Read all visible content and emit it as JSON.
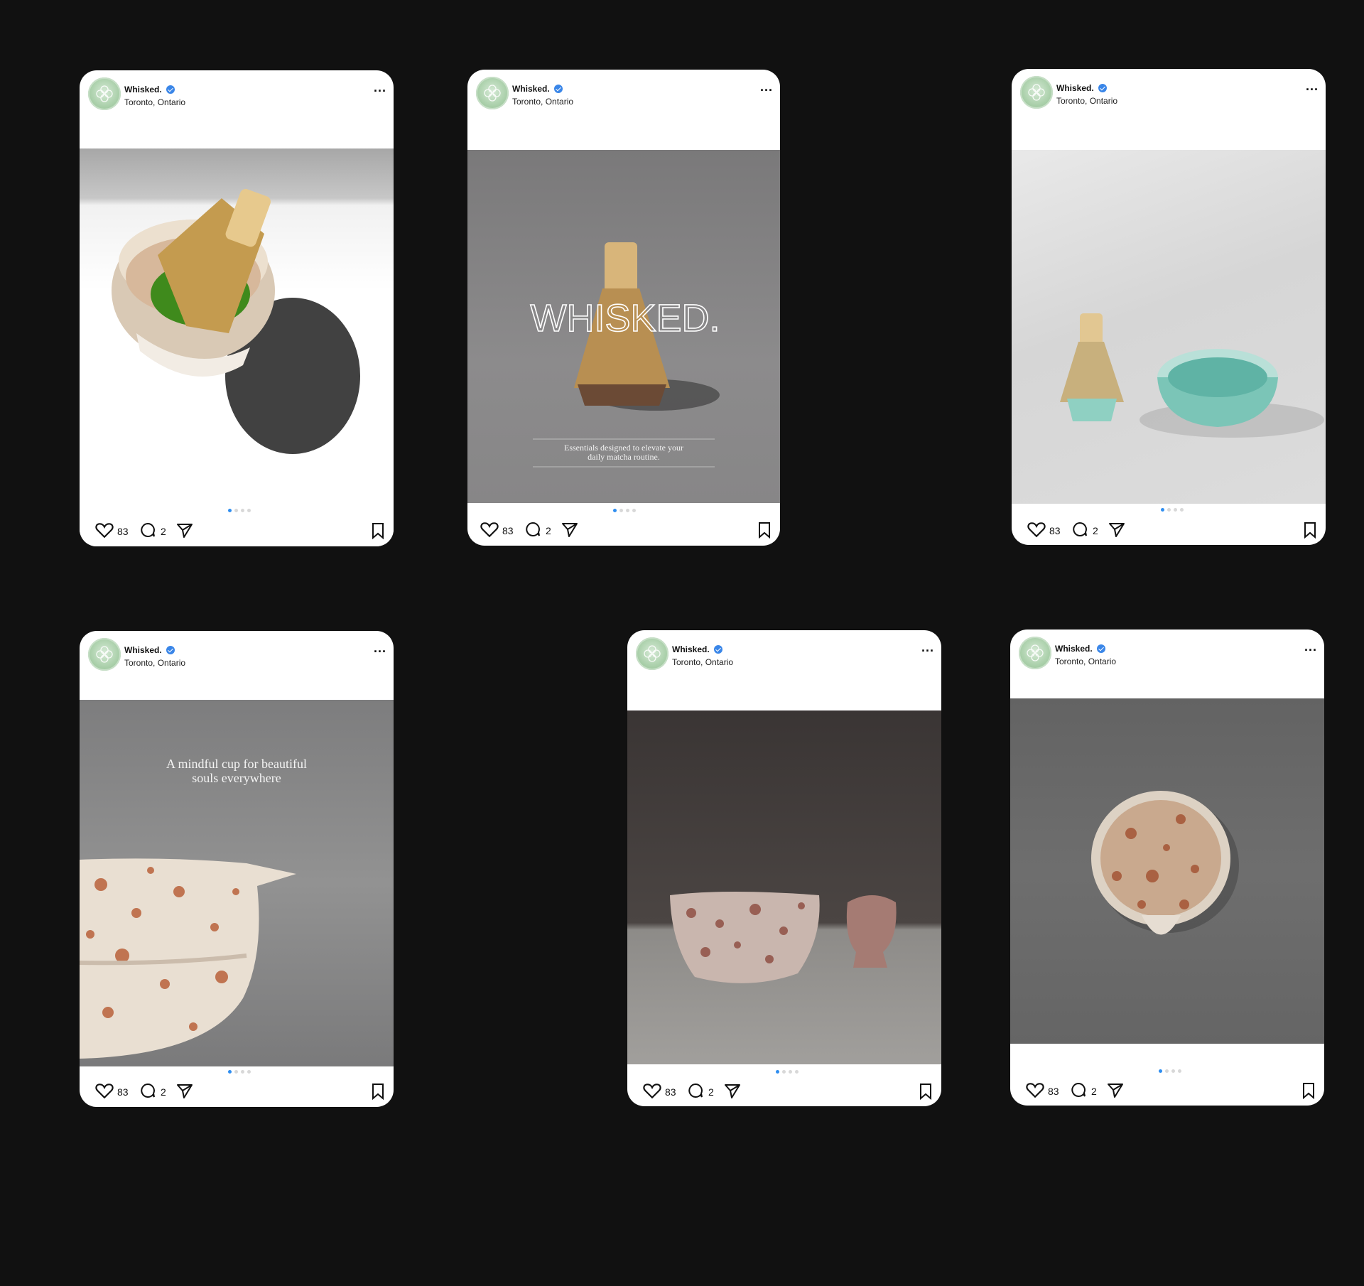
{
  "posts": [
    {
      "username": "Whisked.",
      "location": "Toronto, Ontario",
      "more_label": "...",
      "image_subject": "bamboo matcha whisk in speckled bowl with green tea",
      "likes": "83",
      "comments": "2",
      "carousel_index": 1,
      "carousel_total": 4
    },
    {
      "username": "Whisked.",
      "location": "Toronto, Ontario",
      "more_label": "...",
      "image_subject": "bamboo whisk on holder with brand wordmark",
      "overlay_title": "WHISKED.",
      "overlay_text": "Essentials designed to elevate your daily matcha routine.",
      "likes": "83",
      "comments": "2",
      "carousel_index": 1,
      "carousel_total": 4
    },
    {
      "username": "Whisked.",
      "location": "Toronto, Ontario",
      "more_label": "...",
      "image_subject": "whisk on teal holder beside teal matcha bowl",
      "likes": "83",
      "comments": "2",
      "carousel_index": 1,
      "carousel_total": 4
    },
    {
      "username": "Whisked.",
      "location": "Toronto, Ontario",
      "more_label": "...",
      "image_subject": "close-up of speckled matcha bowl with spout",
      "overlay_text": "A mindful cup for beautiful souls everywhere",
      "likes": "83",
      "comments": "2",
      "carousel_index": 1,
      "carousel_total": 4
    },
    {
      "username": "Whisked.",
      "location": "Toronto, Ontario",
      "more_label": "...",
      "image_subject": "speckled bowl and whisk holder on dark background",
      "likes": "83",
      "comments": "2",
      "carousel_index": 1,
      "carousel_total": 4
    },
    {
      "username": "Whisked.",
      "location": "Toronto, Ontario",
      "more_label": "...",
      "image_subject": "top-down speckled matcha bowl on grey background",
      "likes": "83",
      "comments": "2",
      "carousel_index": 1,
      "carousel_total": 4
    }
  ],
  "icons": {
    "avatar": "leaf-logo-icon",
    "verified": "verified-badge-icon",
    "like": "heart-icon",
    "comment": "comment-icon",
    "share": "send-icon",
    "save": "bookmark-icon"
  },
  "colors": {
    "background": "#111111",
    "card": "#ffffff",
    "verified": "#3a86e8",
    "carousel_active": "#2f8ef0"
  }
}
